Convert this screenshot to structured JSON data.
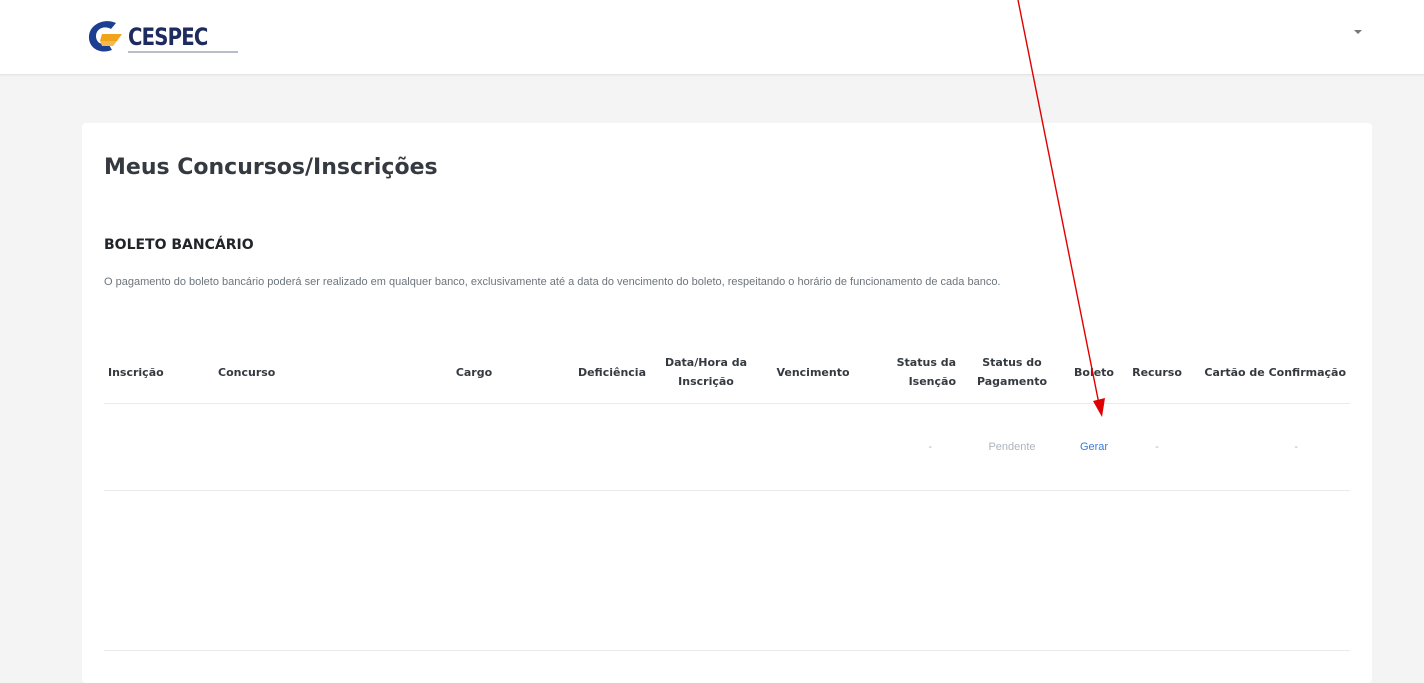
{
  "header": {
    "brand": "CESPEC",
    "brand_colors": {
      "blue": "#1d3f91",
      "orange": "#f0a31b",
      "text": "#1d2b5e"
    }
  },
  "main": {
    "title": "Meus Concursos/Inscrições",
    "section_title": "BOLETO BANCÁRIO",
    "section_text": "O pagamento do boleto bancário poderá ser realizado em qualquer banco, exclusivamente até a data do vencimento do boleto, respeitando o horário de funcionamento de cada banco."
  },
  "table": {
    "columns": [
      "Inscrição",
      "Concurso",
      "Cargo",
      "Deficiência",
      "Data/Hora da Inscrição",
      "Vencimento",
      "Status da Isenção",
      "Status do Pagamento",
      "Boleto",
      "Recurso",
      "Cartão de Confirmação"
    ],
    "rows": [
      {
        "inscricao": "",
        "concurso": "",
        "cargo": "",
        "deficiencia": "",
        "data_hora": "",
        "vencimento": "",
        "status_isencao": "-",
        "status_pagamento": "Pendente",
        "boleto": "Gerar",
        "recurso": "-",
        "cartao": "-"
      }
    ]
  },
  "colors": {
    "pending": "#e06c75",
    "link": "#3b7dd8",
    "annotation_arrow": "#e00000"
  }
}
